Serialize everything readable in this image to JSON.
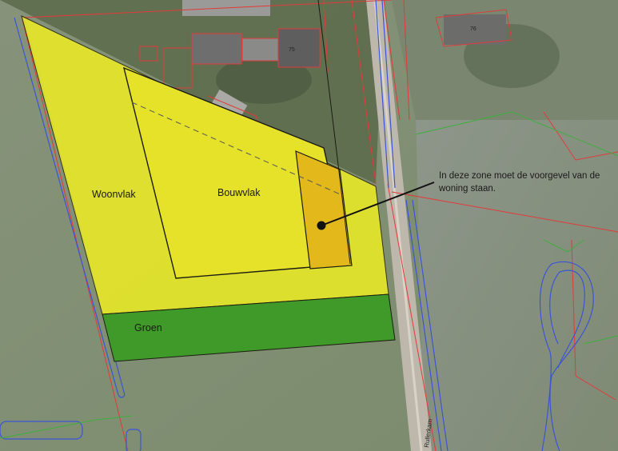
{
  "zones": {
    "woonvlak": "Woonvlak",
    "bouwvlak": "Bouwvlak",
    "groen": "Groen"
  },
  "annotation": {
    "line1": "In deze zone moet de voorgevel van de",
    "line2": "woning staan."
  },
  "house_numbers": {
    "left": "75",
    "right": "76"
  },
  "road_name": "Rullerkam",
  "colors": {
    "woonvlak": "#e8e827",
    "bouwvlak": "#e6e22a",
    "groen": "#3f9a2a",
    "voorgevel_zone": "#e2b81a",
    "parcel_line": "#e23a3a",
    "water_line": "#3b55d6",
    "green_line": "#3fae3f"
  }
}
